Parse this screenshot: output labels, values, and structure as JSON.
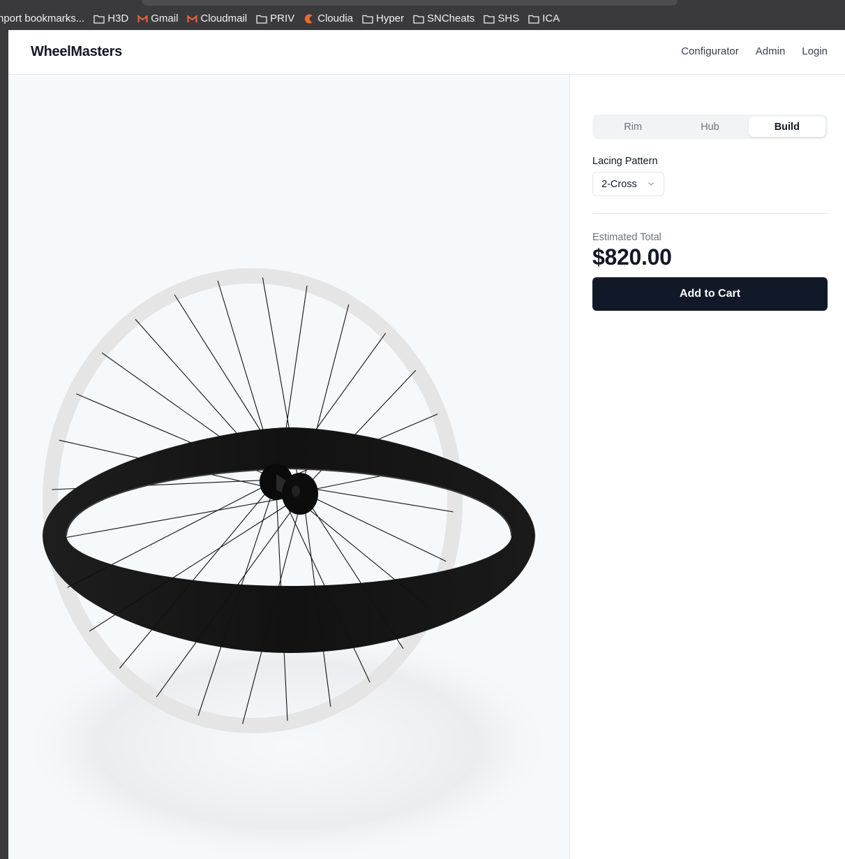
{
  "browser": {
    "bookmarks": [
      {
        "label": "nport bookmarks...",
        "icon": "none"
      },
      {
        "label": "H3D",
        "icon": "folder-icon"
      },
      {
        "label": "Gmail",
        "icon": "gmail-icon"
      },
      {
        "label": "Cloudmail",
        "icon": "gmail-icon"
      },
      {
        "label": "PRIV",
        "icon": "folder-icon"
      },
      {
        "label": "Cloudia",
        "icon": "cloudia-icon"
      },
      {
        "label": "Hyper",
        "icon": "folder-icon"
      },
      {
        "label": "SNCheats",
        "icon": "folder-icon"
      },
      {
        "label": "SHS",
        "icon": "folder-icon"
      },
      {
        "label": "ICA",
        "icon": "folder-icon"
      }
    ]
  },
  "header": {
    "brand": "WheelMasters",
    "nav": [
      "Configurator",
      "Admin",
      "Login"
    ]
  },
  "configurator": {
    "tabs": [
      "Rim",
      "Hub",
      "Build"
    ],
    "active_tab": "Build",
    "lacing_label": "Lacing Pattern",
    "lacing_value": "2-Cross",
    "total_label": "Estimated Total",
    "total_value": "$820.00",
    "add_to_cart": "Add to Cart"
  },
  "colors": {
    "primary": "#111827",
    "muted_text": "#6b7280",
    "border": "#e5e7eb",
    "viewer_bg": "#f6f9fc",
    "rim_color": "#111111",
    "gmail_icon": "#e8613a",
    "cloudia_icon": "#f26a2e"
  }
}
